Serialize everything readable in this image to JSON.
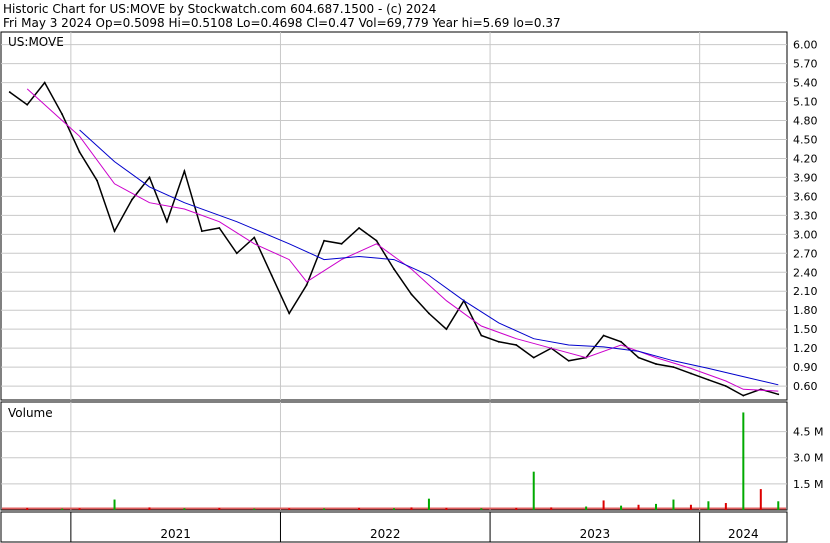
{
  "header": {
    "line1": "Historic Chart for US:MOVE by Stockwatch.com 604.687.1500 - (c) 2024",
    "line2": "Fri May  3 2024  Op=0.5098  Hi=0.5108  Lo=0.4698  Cl=0.47  Vol=69,779  Year hi=5.69  lo=0.37"
  },
  "colors": {
    "price": "#000000",
    "ma_short": "#cc00cc",
    "ma_long": "#0000cc",
    "volume_up": "#00aa00",
    "volume_down": "#dd0000",
    "grid": "#c8c8c8"
  },
  "chart_data": [
    {
      "type": "line",
      "title": "US:MOVE",
      "y_ticks": [
        "6.00",
        "5.70",
        "5.40",
        "5.10",
        "4.80",
        "4.50",
        "4.20",
        "3.90",
        "3.60",
        "3.30",
        "3.00",
        "2.70",
        "2.40",
        "2.10",
        "1.80",
        "1.50",
        "1.20",
        "0.90",
        "0.60"
      ],
      "ylim": [
        0.38,
        6.2
      ],
      "grid": true,
      "x_ticks": [
        "2021",
        "2022",
        "2023",
        "2024"
      ],
      "xlim": [
        "2020-09",
        "2024-05"
      ],
      "series": [
        {
          "style": "price",
          "points": [
            [
              "2020-09",
              5.25
            ],
            [
              "2020-10",
              5.05
            ],
            [
              "2020-11",
              5.4
            ],
            [
              "2020-12",
              4.9
            ],
            [
              "2021-01",
              4.3
            ],
            [
              "2021-02",
              3.85
            ],
            [
              "2021-03",
              3.05
            ],
            [
              "2021-04",
              3.55
            ],
            [
              "2021-05",
              3.9
            ],
            [
              "2021-06",
              3.2
            ],
            [
              "2021-07",
              4.0
            ],
            [
              "2021-08",
              3.05
            ],
            [
              "2021-09",
              3.1
            ],
            [
              "2021-10",
              2.7
            ],
            [
              "2021-11",
              2.95
            ],
            [
              "2021-12",
              2.35
            ],
            [
              "2022-01",
              1.75
            ],
            [
              "2022-02",
              2.2
            ],
            [
              "2022-03",
              2.9
            ],
            [
              "2022-04",
              2.85
            ],
            [
              "2022-05",
              3.1
            ],
            [
              "2022-06",
              2.9
            ],
            [
              "2022-07",
              2.45
            ],
            [
              "2022-08",
              2.05
            ],
            [
              "2022-09",
              1.75
            ],
            [
              "2022-10",
              1.5
            ],
            [
              "2022-11",
              1.95
            ],
            [
              "2022-12",
              1.4
            ],
            [
              "2023-01",
              1.3
            ],
            [
              "2023-02",
              1.25
            ],
            [
              "2023-03",
              1.05
            ],
            [
              "2023-04",
              1.2
            ],
            [
              "2023-05",
              1.0
            ],
            [
              "2023-06",
              1.05
            ],
            [
              "2023-07",
              1.4
            ],
            [
              "2023-08",
              1.3
            ],
            [
              "2023-09",
              1.05
            ],
            [
              "2023-10",
              0.95
            ],
            [
              "2023-11",
              0.9
            ],
            [
              "2023-12",
              0.8
            ],
            [
              "2024-01",
              0.7
            ],
            [
              "2024-02",
              0.6
            ],
            [
              "2024-03",
              0.45
            ],
            [
              "2024-04",
              0.55
            ],
            [
              "2024-05",
              0.47
            ]
          ]
        },
        {
          "style": "ma_short",
          "points": [
            [
              "2020-10",
              5.3
            ],
            [
              "2020-11",
              5.05
            ],
            [
              "2021-01",
              4.55
            ],
            [
              "2021-03",
              3.8
            ],
            [
              "2021-05",
              3.5
            ],
            [
              "2021-07",
              3.4
            ],
            [
              "2021-09",
              3.2
            ],
            [
              "2021-11",
              2.85
            ],
            [
              "2022-01",
              2.6
            ],
            [
              "2022-02",
              2.25
            ],
            [
              "2022-04",
              2.6
            ],
            [
              "2022-06",
              2.85
            ],
            [
              "2022-08",
              2.45
            ],
            [
              "2022-10",
              1.95
            ],
            [
              "2022-12",
              1.55
            ],
            [
              "2023-02",
              1.35
            ],
            [
              "2023-04",
              1.2
            ],
            [
              "2023-06",
              1.05
            ],
            [
              "2023-08",
              1.25
            ],
            [
              "2023-10",
              1.05
            ],
            [
              "2023-12",
              0.88
            ],
            [
              "2024-02",
              0.68
            ],
            [
              "2024-03",
              0.55
            ],
            [
              "2024-05",
              0.52
            ]
          ]
        },
        {
          "style": "ma_long",
          "points": [
            [
              "2021-01",
              4.65
            ],
            [
              "2021-03",
              4.15
            ],
            [
              "2021-05",
              3.75
            ],
            [
              "2021-07",
              3.5
            ],
            [
              "2021-10",
              3.2
            ],
            [
              "2022-01",
              2.85
            ],
            [
              "2022-03",
              2.6
            ],
            [
              "2022-05",
              2.65
            ],
            [
              "2022-07",
              2.6
            ],
            [
              "2022-09",
              2.35
            ],
            [
              "2022-11",
              1.95
            ],
            [
              "2023-01",
              1.6
            ],
            [
              "2023-03",
              1.35
            ],
            [
              "2023-05",
              1.25
            ],
            [
              "2023-07",
              1.22
            ],
            [
              "2023-09",
              1.15
            ],
            [
              "2023-11",
              1.0
            ],
            [
              "2024-01",
              0.88
            ],
            [
              "2024-03",
              0.75
            ],
            [
              "2024-05",
              0.62
            ]
          ]
        }
      ]
    },
    {
      "type": "bar",
      "title": "Volume",
      "y_ticks": [
        "4.5 M",
        "3.0 M",
        "1.5 M"
      ],
      "ylim": [
        0,
        6.2
      ],
      "grid": true,
      "x_ticks": [
        "2021",
        "2022",
        "2023",
        "2024"
      ],
      "bars": [
        [
          "2020-10",
          0.12,
          "down"
        ],
        [
          "2020-12",
          0.08,
          "up"
        ],
        [
          "2021-01",
          0.1,
          "down"
        ],
        [
          "2021-03",
          0.6,
          "up"
        ],
        [
          "2021-05",
          0.15,
          "down"
        ],
        [
          "2021-07",
          0.1,
          "up"
        ],
        [
          "2021-09",
          0.12,
          "down"
        ],
        [
          "2021-11",
          0.08,
          "up"
        ],
        [
          "2022-01",
          0.1,
          "down"
        ],
        [
          "2022-03",
          0.09,
          "up"
        ],
        [
          "2022-05",
          0.12,
          "down"
        ],
        [
          "2022-07",
          0.1,
          "up"
        ],
        [
          "2022-08",
          0.15,
          "down"
        ],
        [
          "2022-09",
          0.65,
          "up"
        ],
        [
          "2022-10",
          0.12,
          "down"
        ],
        [
          "2022-12",
          0.1,
          "up"
        ],
        [
          "2023-02",
          0.12,
          "down"
        ],
        [
          "2023-03",
          2.2,
          "up"
        ],
        [
          "2023-04",
          0.15,
          "down"
        ],
        [
          "2023-06",
          0.2,
          "up"
        ],
        [
          "2023-07",
          0.55,
          "down"
        ],
        [
          "2023-08",
          0.25,
          "up"
        ],
        [
          "2023-09",
          0.3,
          "down"
        ],
        [
          "2023-10",
          0.35,
          "up"
        ],
        [
          "2023-11",
          0.6,
          "up"
        ],
        [
          "2023-12",
          0.3,
          "down"
        ],
        [
          "2024-01",
          0.5,
          "up"
        ],
        [
          "2024-02",
          0.4,
          "down"
        ],
        [
          "2024-03",
          5.6,
          "up"
        ],
        [
          "2024-04",
          1.2,
          "down"
        ],
        [
          "2024-05",
          0.5,
          "up"
        ]
      ]
    }
  ]
}
